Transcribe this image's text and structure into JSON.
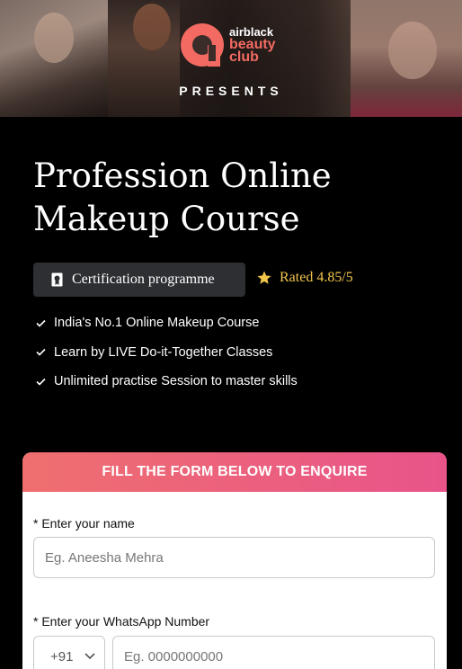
{
  "hero": {
    "logo": {
      "line1": "airblack",
      "line2": "beauty",
      "line3": "club"
    },
    "presents": "PRESENTS"
  },
  "course": {
    "title": "Profession Online Makeup Course",
    "certification_label": "Certification programme",
    "rating_text": "Rated 4.85/5",
    "features": [
      "India's No.1 Online Makeup Course",
      "Learn by LIVE Do-it-Together Classes",
      "Unlimited practise Session to master skills"
    ]
  },
  "form": {
    "title": "FILL THE FORM BELOW TO ENQUIRE",
    "name_label": "* Enter your name",
    "name_placeholder": "Eg. Aneesha Mehra",
    "whatsapp_label": "* Enter your WhatsApp Number",
    "country_code": "+91",
    "phone_placeholder": "Eg. 0000000000"
  },
  "colors": {
    "accent": "#f26a62",
    "rating": "#f2c64b",
    "form_header_start": "#ef6f6f",
    "form_header_end": "#e8548a",
    "badge_bg": "#2e2f33"
  }
}
